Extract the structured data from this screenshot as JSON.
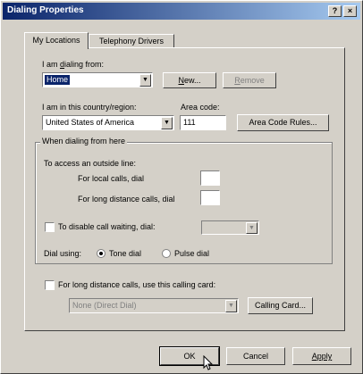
{
  "window": {
    "title": "Dialing Properties",
    "help_glyph": "?",
    "close_glyph": "×"
  },
  "tabs": [
    {
      "label": "My Locations"
    },
    {
      "label": "Telephony Drivers"
    }
  ],
  "location": {
    "label_before": "I am ",
    "label_mnemonic": "d",
    "label_after": "ialing from:",
    "value": "Home",
    "new_before": "",
    "new_mnemonic": "N",
    "new_after": "ew...",
    "remove_before": "",
    "remove_mnemonic": "R",
    "remove_after": "emove"
  },
  "country": {
    "label": "I am in this country/region:",
    "value": "United States of America",
    "area_code_label": "Area code:",
    "area_code_value": "111",
    "rules_button": "Area Code Rules..."
  },
  "dialing_group": {
    "title": "When dialing from here",
    "outside_line_label": "To access an outside line:",
    "local_label": "For local calls, dial",
    "local_value": "",
    "long_distance_label": "For long distance calls, dial",
    "long_distance_value": "",
    "call_waiting_label": "To disable call waiting, dial:",
    "call_waiting_checked": false,
    "call_waiting_value": "",
    "dial_using_label": "Dial using:",
    "tone_label": "Tone dial",
    "pulse_label": "Pulse dial",
    "selected_mode": "tone"
  },
  "calling_card": {
    "checkbox_label": "For long distance calls, use this calling card:",
    "checked": false,
    "card_value": "None (Direct Dial)",
    "button": "Calling Card..."
  },
  "footer": {
    "ok": "OK",
    "cancel": "Cancel",
    "apply": "Apply"
  },
  "colors": {
    "title_gradient_start": "#0a246a",
    "title_gradient_end": "#a6caf0",
    "selection": "#0a246a",
    "face": "#d4d0c8"
  }
}
